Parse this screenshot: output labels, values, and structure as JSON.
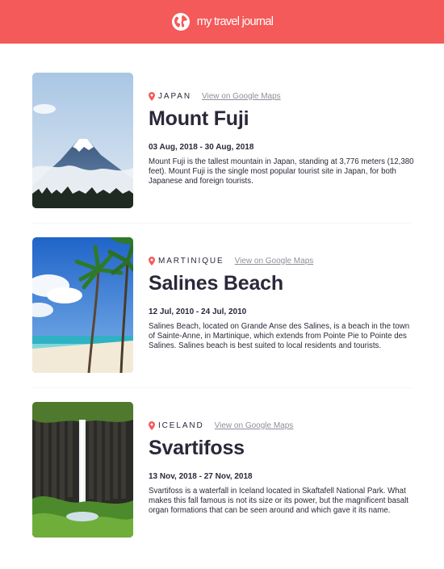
{
  "header": {
    "title": "my travel journal",
    "icon": "globe-icon",
    "background": "#f55a5a"
  },
  "accent": "#f55a5a",
  "entries": [
    {
      "country": "JAPAN",
      "maps_link": "View on Google Maps",
      "place": "Mount Fuji",
      "dates": "03 Aug, 2018 - 30 Aug, 2018",
      "description": "Mount Fuji is the tallest mountain in Japan, standing at 3,776 meters (12,380 feet). Mount Fuji is the single most popular tourist site in Japan, for both Japanese and foreign tourists.",
      "photo": "mount-fuji-photo"
    },
    {
      "country": "MARTINIQUE",
      "maps_link": "View on Google Maps",
      "place": "Salines Beach",
      "dates": "12 Jul, 2010 - 24 Jul, 2010",
      "description": "Salines Beach, located on Grande Anse des Salines, is a beach in the town of Sainte-Anne, in Martinique, which extends from Pointe Pie to Pointe des Salines. Salines beach is best suited to local residents and tourists.",
      "photo": "salines-beach-photo"
    },
    {
      "country": "ICELAND",
      "maps_link": "View on Google Maps",
      "place": "Svartifoss",
      "dates": "13 Nov, 2018 - 27 Nov, 2018",
      "description": "Svartifoss is a waterfall in Iceland located in Skaftafell National Park. What makes this fall famous is not its size or its power, but the magnificent basalt organ formations that can be seen around and which gave it its name.",
      "photo": "svartifoss-photo"
    }
  ]
}
